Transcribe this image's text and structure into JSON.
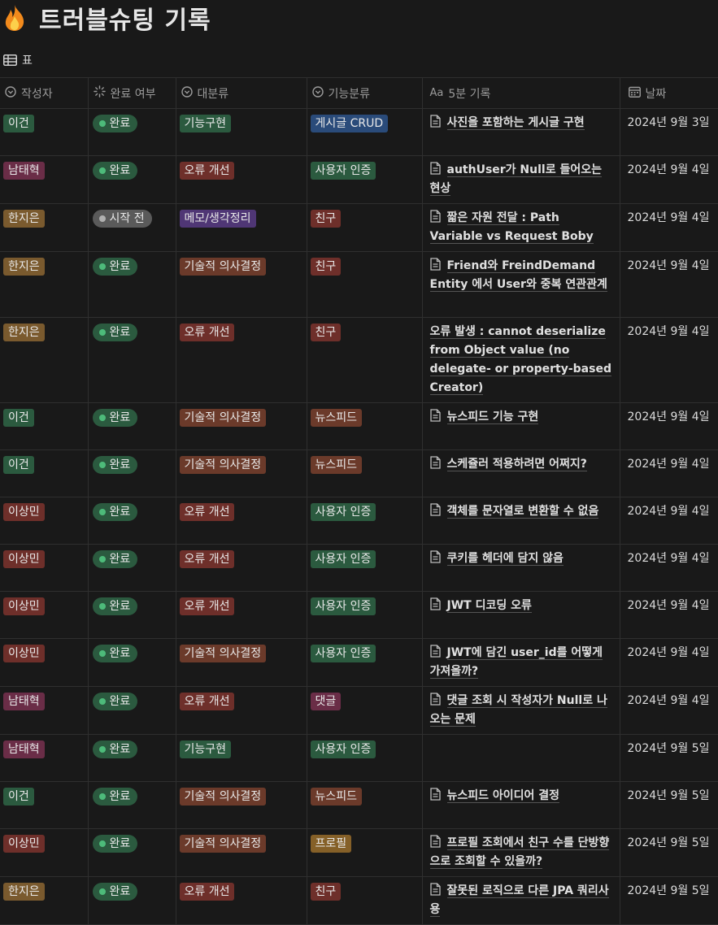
{
  "page": {
    "icon": "fire-icon",
    "title": "트러블슈팅 기록",
    "view_icon": "table-icon",
    "view_label": "표"
  },
  "colors": {
    "green": "#2b5a3f",
    "red": "#6e2f2a",
    "pink": "#6a2d47",
    "brown": "#7a5a2e",
    "orange": "#6b3a2a",
    "purple": "#4f3675",
    "blue": "#2a4b7a",
    "gold": "#856028",
    "status_done": "#2b5a3f",
    "status_todo": "#5a5a5a"
  },
  "columns": [
    {
      "icon": "select-icon",
      "label": "작성자"
    },
    {
      "icon": "status-icon",
      "label": "완료 여부"
    },
    {
      "icon": "select-icon",
      "label": "대분류"
    },
    {
      "icon": "select-icon",
      "label": "기능분류"
    },
    {
      "icon": "title-icon",
      "prefix": "Aa",
      "label": "5분 기록"
    },
    {
      "icon": "calendar-icon",
      "label": "날짜"
    }
  ],
  "rows": [
    {
      "author": "이건",
      "author_color": "green",
      "status": "완료",
      "status_kind": "done",
      "category": "기능구현",
      "category_color": "green",
      "feature": "게시글 CRUD",
      "feature_color": "blue",
      "title": "사진을 포함하는 게시글 구현",
      "has_icon": true,
      "date": "2024년 9월 3일"
    },
    {
      "author": "남태혁",
      "author_color": "pink",
      "status": "완료",
      "status_kind": "done",
      "category": "오류 개선",
      "category_color": "red",
      "feature": "사용자 인증",
      "feature_color": "green",
      "title": "authUser가 Null로 들어오는 현상",
      "has_icon": true,
      "date": "2024년 9월 4일"
    },
    {
      "author": "한지은",
      "author_color": "brown",
      "status": "시작 전",
      "status_kind": "todo",
      "category": "메모/생각정리",
      "category_color": "purple",
      "feature": "친구",
      "feature_color": "red",
      "title": "짧은 자원 전달 : Path Variable vs Request Boby",
      "has_icon": true,
      "date": "2024년 9월 4일"
    },
    {
      "author": "한지은",
      "author_color": "brown",
      "status": "완료",
      "status_kind": "done",
      "category": "기술적 의사결정",
      "category_color": "orange",
      "feature": "친구",
      "feature_color": "red",
      "title": "Friend와 FreindDemand Entity 에서 User와 중복 연관관계",
      "has_icon": true,
      "date": "2024년 9월 4일"
    },
    {
      "author": "한지은",
      "author_color": "brown",
      "status": "완료",
      "status_kind": "done",
      "category": "오류 개선",
      "category_color": "red",
      "feature": "친구",
      "feature_color": "red",
      "title": "오류 발생 : cannot deserialize from Object value (no delegate- or property-based Creator)",
      "has_icon": false,
      "date": "2024년 9월 4일"
    },
    {
      "author": "이건",
      "author_color": "green",
      "status": "완료",
      "status_kind": "done",
      "category": "기술적 의사결정",
      "category_color": "orange",
      "feature": "뉴스피드",
      "feature_color": "orange",
      "title": "뉴스피드 기능 구현",
      "has_icon": true,
      "date": "2024년 9월 4일"
    },
    {
      "author": "이건",
      "author_color": "green",
      "status": "완료",
      "status_kind": "done",
      "category": "기술적 의사결정",
      "category_color": "orange",
      "feature": "뉴스피드",
      "feature_color": "orange",
      "title": "스케쥴러 적용하려면 어쩌지?",
      "has_icon": true,
      "date": "2024년 9월 4일"
    },
    {
      "author": "이상민",
      "author_color": "red",
      "status": "완료",
      "status_kind": "done",
      "category": "오류 개선",
      "category_color": "red",
      "feature": "사용자 인증",
      "feature_color": "green",
      "title": "객체를 문자열로 변환할 수 없음",
      "has_icon": true,
      "date": "2024년 9월 4일"
    },
    {
      "author": "이상민",
      "author_color": "red",
      "status": "완료",
      "status_kind": "done",
      "category": "오류 개선",
      "category_color": "red",
      "feature": "사용자 인증",
      "feature_color": "green",
      "title": "쿠키를 헤더에 담지 않음",
      "has_icon": true,
      "date": "2024년 9월 4일"
    },
    {
      "author": "이상민",
      "author_color": "red",
      "status": "완료",
      "status_kind": "done",
      "category": "오류 개선",
      "category_color": "red",
      "feature": "사용자 인증",
      "feature_color": "green",
      "title": "JWT 디코딩 오류",
      "has_icon": true,
      "date": "2024년 9월 4일"
    },
    {
      "author": "이상민",
      "author_color": "red",
      "status": "완료",
      "status_kind": "done",
      "category": "기술적 의사결정",
      "category_color": "orange",
      "feature": "사용자 인증",
      "feature_color": "green",
      "title": "JWT에 담긴 user_id를 어떻게 가져올까?",
      "has_icon": true,
      "date": "2024년 9월 4일"
    },
    {
      "author": "남태혁",
      "author_color": "pink",
      "status": "완료",
      "status_kind": "done",
      "category": "오류 개선",
      "category_color": "red",
      "feature": "댓글",
      "feature_color": "pink",
      "title": "댓글 조회 시 작성자가 Null로 나오는 문제",
      "has_icon": true,
      "date": "2024년 9월 4일"
    },
    {
      "author": "남태혁",
      "author_color": "pink",
      "status": "완료",
      "status_kind": "done",
      "category": "기능구현",
      "category_color": "green",
      "feature": "사용자 인증",
      "feature_color": "green",
      "title": "",
      "has_icon": false,
      "date": "2024년 9월 5일"
    },
    {
      "author": "이건",
      "author_color": "green",
      "status": "완료",
      "status_kind": "done",
      "category": "기술적 의사결정",
      "category_color": "orange",
      "feature": "뉴스피드",
      "feature_color": "orange",
      "title": "뉴스피드 아이디어 결정",
      "has_icon": true,
      "date": "2024년 9월 5일"
    },
    {
      "author": "이상민",
      "author_color": "red",
      "status": "완료",
      "status_kind": "done",
      "category": "기술적 의사결정",
      "category_color": "orange",
      "feature": "프로필",
      "feature_color": "gold",
      "title": "프로필 조회에서 친구 수를 단방향 으로 조회할 수 있을까?",
      "has_icon": true,
      "date": "2024년 9월 5일"
    },
    {
      "author": "한지은",
      "author_color": "brown",
      "status": "완료",
      "status_kind": "done",
      "category": "오류 개선",
      "category_color": "red",
      "feature": "친구",
      "feature_color": "red",
      "title": "잘못된 로직으로 다른 JPA 쿼리사용",
      "has_icon": true,
      "date": "2024년 9월 5일"
    }
  ]
}
